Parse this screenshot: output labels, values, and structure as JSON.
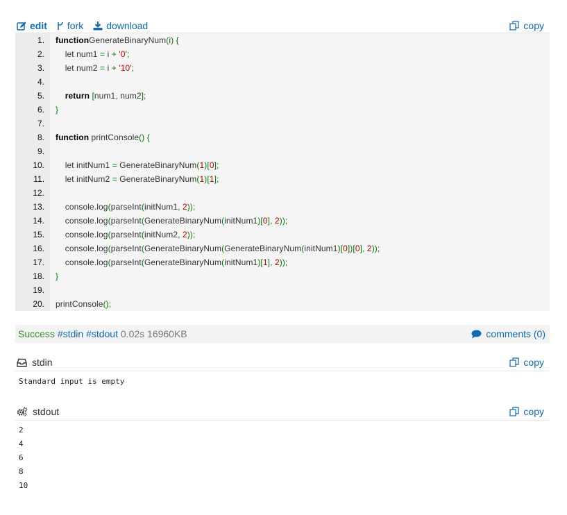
{
  "toolbar": {
    "edit_label": "edit",
    "fork_label": "fork",
    "download_label": "download",
    "copy_label": "copy"
  },
  "code": {
    "lines": [
      {
        "n": "1.",
        "tokens": [
          [
            "kw",
            "function"
          ],
          [
            "",
            "GenerateBinaryNum"
          ],
          [
            "pun",
            "("
          ],
          [
            "",
            "i"
          ],
          [
            "pun",
            ")"
          ],
          [
            "",
            " "
          ],
          [
            "pun",
            "{"
          ]
        ]
      },
      {
        "n": "2.",
        "tokens": [
          [
            "",
            "    "
          ],
          [
            "",
            "let num1 "
          ],
          [
            "pun",
            "="
          ],
          [
            "",
            " i "
          ],
          [
            "pun",
            "+"
          ],
          [
            "",
            " "
          ],
          [
            "str",
            "'0'"
          ],
          [
            "pun",
            ";"
          ]
        ]
      },
      {
        "n": "3.",
        "tokens": [
          [
            "",
            "    "
          ],
          [
            "",
            "let num2 "
          ],
          [
            "pun",
            "="
          ],
          [
            "",
            " i "
          ],
          [
            "pun",
            "+"
          ],
          [
            "",
            " "
          ],
          [
            "str",
            "'10'"
          ],
          [
            "pun",
            ";"
          ]
        ]
      },
      {
        "n": "4.",
        "tokens": []
      },
      {
        "n": "5.",
        "tokens": [
          [
            "",
            "    "
          ],
          [
            "kw",
            "return"
          ],
          [
            "",
            " "
          ],
          [
            "pun",
            "["
          ],
          [
            "",
            "num1"
          ],
          [
            "pun",
            ","
          ],
          [
            "",
            " num2"
          ],
          [
            "pun",
            "];"
          ]
        ]
      },
      {
        "n": "6.",
        "tokens": [
          [
            "pun",
            "}"
          ]
        ]
      },
      {
        "n": "7.",
        "tokens": []
      },
      {
        "n": "8.",
        "tokens": [
          [
            "kw",
            "function"
          ],
          [
            "",
            " printConsole"
          ],
          [
            "pun",
            "()"
          ],
          [
            "",
            " "
          ],
          [
            "pun",
            "{"
          ]
        ]
      },
      {
        "n": "9.",
        "tokens": []
      },
      {
        "n": "10.",
        "tokens": [
          [
            "",
            "    "
          ],
          [
            "",
            "let initNum1 "
          ],
          [
            "pun",
            "="
          ],
          [
            "",
            " GenerateBinaryNum"
          ],
          [
            "pun",
            "("
          ],
          [
            "num",
            "1"
          ],
          [
            "pun",
            ")["
          ],
          [
            "num",
            "0"
          ],
          [
            "pun",
            "];"
          ]
        ]
      },
      {
        "n": "11.",
        "tokens": [
          [
            "",
            "    "
          ],
          [
            "",
            "let initNum2 "
          ],
          [
            "pun",
            "="
          ],
          [
            "",
            " GenerateBinaryNum"
          ],
          [
            "pun",
            "("
          ],
          [
            "num",
            "1"
          ],
          [
            "pun",
            ")["
          ],
          [
            "num",
            "1"
          ],
          [
            "pun",
            "];"
          ]
        ]
      },
      {
        "n": "12.",
        "tokens": []
      },
      {
        "n": "13.",
        "tokens": [
          [
            "",
            "    "
          ],
          [
            "",
            "console"
          ],
          [
            "pun",
            "."
          ],
          [
            "",
            "log"
          ],
          [
            "pun",
            "("
          ],
          [
            "",
            "parseInt"
          ],
          [
            "pun",
            "("
          ],
          [
            "",
            "initNum1"
          ],
          [
            "pun",
            ","
          ],
          [
            "",
            " "
          ],
          [
            "num",
            "2"
          ],
          [
            "pun",
            "));"
          ]
        ]
      },
      {
        "n": "14.",
        "tokens": [
          [
            "",
            "    "
          ],
          [
            "",
            "console"
          ],
          [
            "pun",
            "."
          ],
          [
            "",
            "log"
          ],
          [
            "pun",
            "("
          ],
          [
            "",
            "parseInt"
          ],
          [
            "pun",
            "("
          ],
          [
            "",
            "GenerateBinaryNum"
          ],
          [
            "pun",
            "("
          ],
          [
            "",
            "initNum1"
          ],
          [
            "pun",
            ")["
          ],
          [
            "num",
            "0"
          ],
          [
            "pun",
            "],"
          ],
          [
            "",
            " "
          ],
          [
            "num",
            "2"
          ],
          [
            "pun",
            "));"
          ]
        ]
      },
      {
        "n": "15.",
        "tokens": [
          [
            "",
            "    "
          ],
          [
            "",
            "console"
          ],
          [
            "pun",
            "."
          ],
          [
            "",
            "log"
          ],
          [
            "pun",
            "("
          ],
          [
            "",
            "parseInt"
          ],
          [
            "pun",
            "("
          ],
          [
            "",
            "initNum2"
          ],
          [
            "pun",
            ","
          ],
          [
            "",
            " "
          ],
          [
            "num",
            "2"
          ],
          [
            "pun",
            "));"
          ]
        ]
      },
      {
        "n": "16.",
        "tokens": [
          [
            "",
            "    "
          ],
          [
            "",
            "console"
          ],
          [
            "pun",
            "."
          ],
          [
            "",
            "log"
          ],
          [
            "pun",
            "("
          ],
          [
            "",
            "parseInt"
          ],
          [
            "pun",
            "("
          ],
          [
            "",
            "GenerateBinaryNum"
          ],
          [
            "pun",
            "("
          ],
          [
            "",
            "GenerateBinaryNum"
          ],
          [
            "pun",
            "("
          ],
          [
            "",
            "initNum1"
          ],
          [
            "pun",
            ")["
          ],
          [
            "num",
            "0"
          ],
          [
            "pun",
            "])["
          ],
          [
            "num",
            "0"
          ],
          [
            "pun",
            "],"
          ],
          [
            "",
            " "
          ],
          [
            "num",
            "2"
          ],
          [
            "pun",
            "));"
          ]
        ]
      },
      {
        "n": "17.",
        "tokens": [
          [
            "",
            "    "
          ],
          [
            "",
            "console"
          ],
          [
            "pun",
            "."
          ],
          [
            "",
            "log"
          ],
          [
            "pun",
            "("
          ],
          [
            "",
            "parseInt"
          ],
          [
            "pun",
            "("
          ],
          [
            "",
            "GenerateBinaryNum"
          ],
          [
            "pun",
            "("
          ],
          [
            "",
            "initNum1"
          ],
          [
            "pun",
            ")["
          ],
          [
            "num",
            "1"
          ],
          [
            "pun",
            "],"
          ],
          [
            "",
            " "
          ],
          [
            "num",
            "2"
          ],
          [
            "pun",
            "));"
          ]
        ]
      },
      {
        "n": "18.",
        "tokens": [
          [
            "pun",
            "}"
          ]
        ]
      },
      {
        "n": "19.",
        "tokens": []
      },
      {
        "n": "20.",
        "tokens": [
          [
            "",
            "printConsole"
          ],
          [
            "pun",
            "();"
          ]
        ]
      }
    ]
  },
  "status": {
    "result": "Success",
    "stdin_link": "#stdin",
    "stdout_link": "#stdout",
    "time": "0.02s",
    "memory": "16960KB",
    "comments_label": "comments (0)"
  },
  "stdin": {
    "title": "stdin",
    "copy_label": "copy",
    "content": "Standard input is empty"
  },
  "stdout": {
    "title": "stdout",
    "copy_label": "copy",
    "lines": [
      "2",
      "4",
      "6",
      "8",
      "10"
    ]
  },
  "colors": {
    "link": "#0e6bb5",
    "success": "#3a8c2f",
    "string": "#b00",
    "punctuation": "#070"
  }
}
